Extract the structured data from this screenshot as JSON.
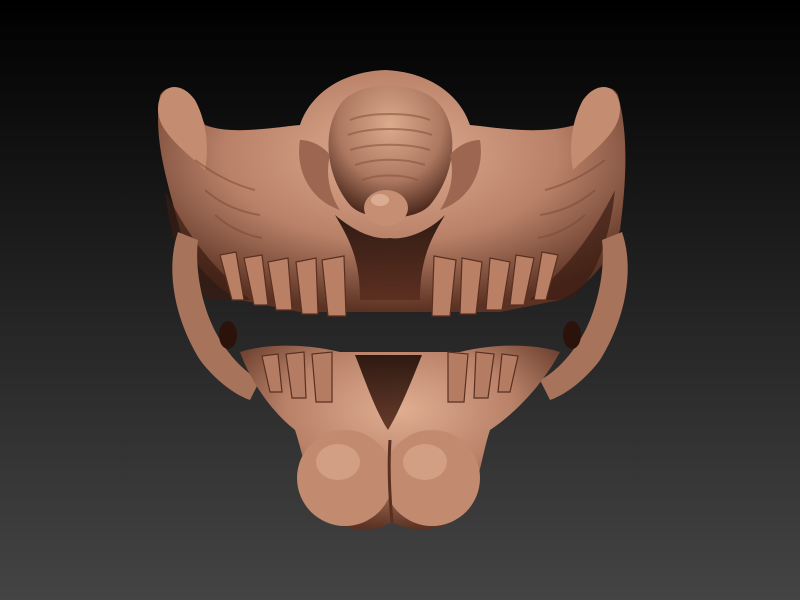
{
  "scene": {
    "subject": "mask-render",
    "colors": {
      "background_top": "#000000",
      "background_bottom": "#444444",
      "clay_light": "#d6a286",
      "clay_mid": "#b47e66",
      "clay_dark": "#6e3f2c",
      "shadow": "#2a140d"
    }
  }
}
